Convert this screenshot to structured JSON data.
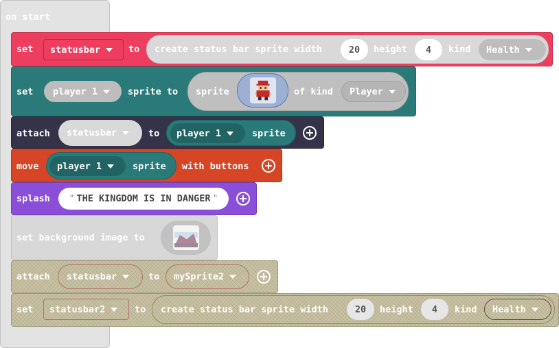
{
  "on_start": {
    "label": "on start"
  },
  "set_statusbar": {
    "set_label": "set",
    "var": "statusbar",
    "to_label": "to",
    "create_label": "create status bar sprite width",
    "width": "20",
    "height_label": "height",
    "height": "4",
    "kind_label": "kind",
    "kind": "Health"
  },
  "set_player": {
    "set_label": "set",
    "var": "player 1",
    "sprite_to_label": "sprite to",
    "sprite_label": "sprite",
    "of_kind_label": "of kind",
    "kind": "Player"
  },
  "attach1": {
    "attach_label": "attach",
    "statusbar": "statusbar",
    "to_label": "to",
    "target": "player 1",
    "sprite_label": "sprite"
  },
  "move": {
    "move_label": "move",
    "target": "player 1",
    "sprite_label": "sprite",
    "with_buttons_label": "with buttons"
  },
  "splash": {
    "splash_label": "splash",
    "text": "THE KINGDOM IS IN DANGER"
  },
  "set_background": {
    "label": "set background image to"
  },
  "attach2": {
    "attach_label": "attach",
    "statusbar": "statusbar",
    "to_label": "to",
    "target": "mySprite2"
  },
  "set_statusbar2": {
    "set_label": "set",
    "var": "statusbar2",
    "to_label": "to",
    "create_label": "create status bar sprite width",
    "width": "20",
    "height_label": "height",
    "height": "4",
    "kind_label": "kind",
    "kind": "Health"
  },
  "colors": {
    "on_start": "#e6e6e6",
    "statusbar_block": "#ee3e5f",
    "sprites_block": "#2a7a7a",
    "statusbar_dark": "#35334a",
    "controller": "#d64525",
    "scene_splash": "#8a4ed9",
    "disabled": "#d8d8d8",
    "hatched": "#c7c2a4"
  }
}
